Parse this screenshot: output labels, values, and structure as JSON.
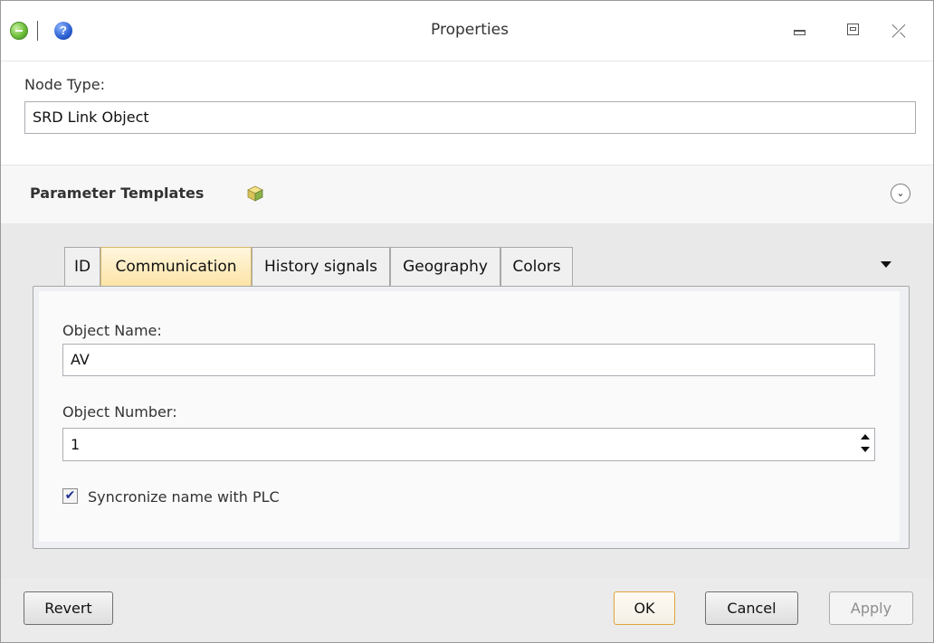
{
  "window": {
    "title": "Properties"
  },
  "titlebar": {
    "app_icon": "app-globe-icon",
    "help_icon": "help-icon",
    "help_glyph": "?",
    "close_glyph": "⤫"
  },
  "node_type": {
    "label": "Node Type:",
    "value": "SRD Link Object"
  },
  "parameter_templates": {
    "label": "Parameter Templates",
    "icon": "cube-icon",
    "expander_glyph": "⌄"
  },
  "tabs": [
    {
      "label": "ID",
      "active": false
    },
    {
      "label": "Communication",
      "active": true
    },
    {
      "label": "History signals",
      "active": false
    },
    {
      "label": "Geography",
      "active": false
    },
    {
      "label": "Colors",
      "active": false
    }
  ],
  "communication": {
    "object_name_label": "Object Name:",
    "object_name_value": "AV",
    "object_number_label": "Object Number:",
    "object_number_value": "1",
    "sync_label": "Syncronize name with PLC",
    "sync_checked": true,
    "check_glyph": "✔"
  },
  "footer": {
    "revert": "Revert",
    "ok": "OK",
    "cancel": "Cancel",
    "apply": "Apply"
  },
  "colors": {
    "active_tab": "#fde4a6",
    "default_button_border": "#e0a43a"
  }
}
